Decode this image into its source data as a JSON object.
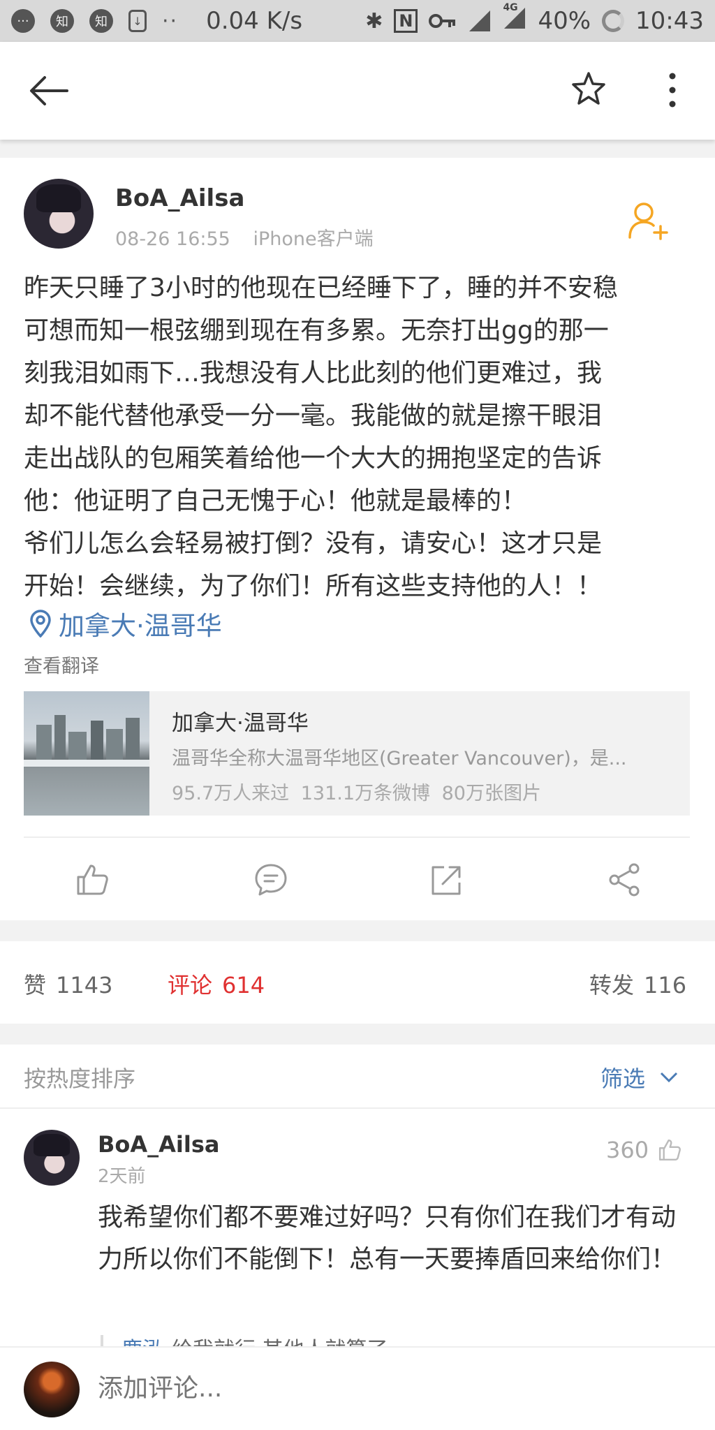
{
  "status_bar": {
    "icon_zhi_1": "知",
    "icon_zhi_2": "知",
    "dots": "··",
    "net_speed": "0.04 K/s",
    "nfc": "N",
    "signal_type": "4G",
    "battery": "40%",
    "time": "10:43"
  },
  "nav": {
    "back_icon": "arrow-left",
    "star_icon": "star-outline",
    "more_icon": "vertical-dots"
  },
  "post": {
    "username": "BoA_Ailsa",
    "time": "08-26 16:55",
    "source": "iPhone客户端",
    "text_lines": [
      "昨天只睡了3小时的他现在已经睡下了，睡的并不安稳",
      "可想而知一根弦绷到现在有多累。无奈打出gg的那一",
      "刻我泪如雨下…我想没有人比此刻的他们更难过，我",
      "却不能代替他承受一分一毫。我能做的就是擦干眼泪",
      "走出战队的包厢笑着给他一个大大的拥抱坚定的告诉",
      "他：他证明了自己无愧于心！他就是最棒的！",
      "爷们儿怎么会轻易被打倒？没有，请安心！这才只是",
      "开始！会继续，为了你们！所有这些支持他的人！！"
    ],
    "location": "加拿大·温哥华",
    "translate": "查看翻译",
    "place_card": {
      "title": "加拿大·温哥华",
      "description": "温哥华全称大温哥华地区(Greater Vancouver)，是...",
      "visitors": "95.7万人来过",
      "posts": "131.1万条微博",
      "photos": "80万张图片"
    },
    "accent_color": "#4a7bb5",
    "follow_color": "#f5a623"
  },
  "stats": {
    "likes_label": "赞",
    "likes": "1143",
    "comments_label": "评论",
    "comments": "614",
    "reposts_label": "转发",
    "reposts": "116",
    "active_color": "#e03131"
  },
  "comments": {
    "sort_label": "按热度排序",
    "filter_label": "筛选",
    "items": [
      {
        "username": "BoA_Ailsa",
        "time": "2天前",
        "likes": "360",
        "text": "我希望你们都不要难过好吗？只有你们在我们才有动力所以你们不能倒下！总有一天要捧盾回来给你们！",
        "reply_name": "鹿泓",
        "reply_text": "给我就行,其他人就算了"
      }
    ]
  },
  "compose": {
    "placeholder": "添加评论..."
  }
}
